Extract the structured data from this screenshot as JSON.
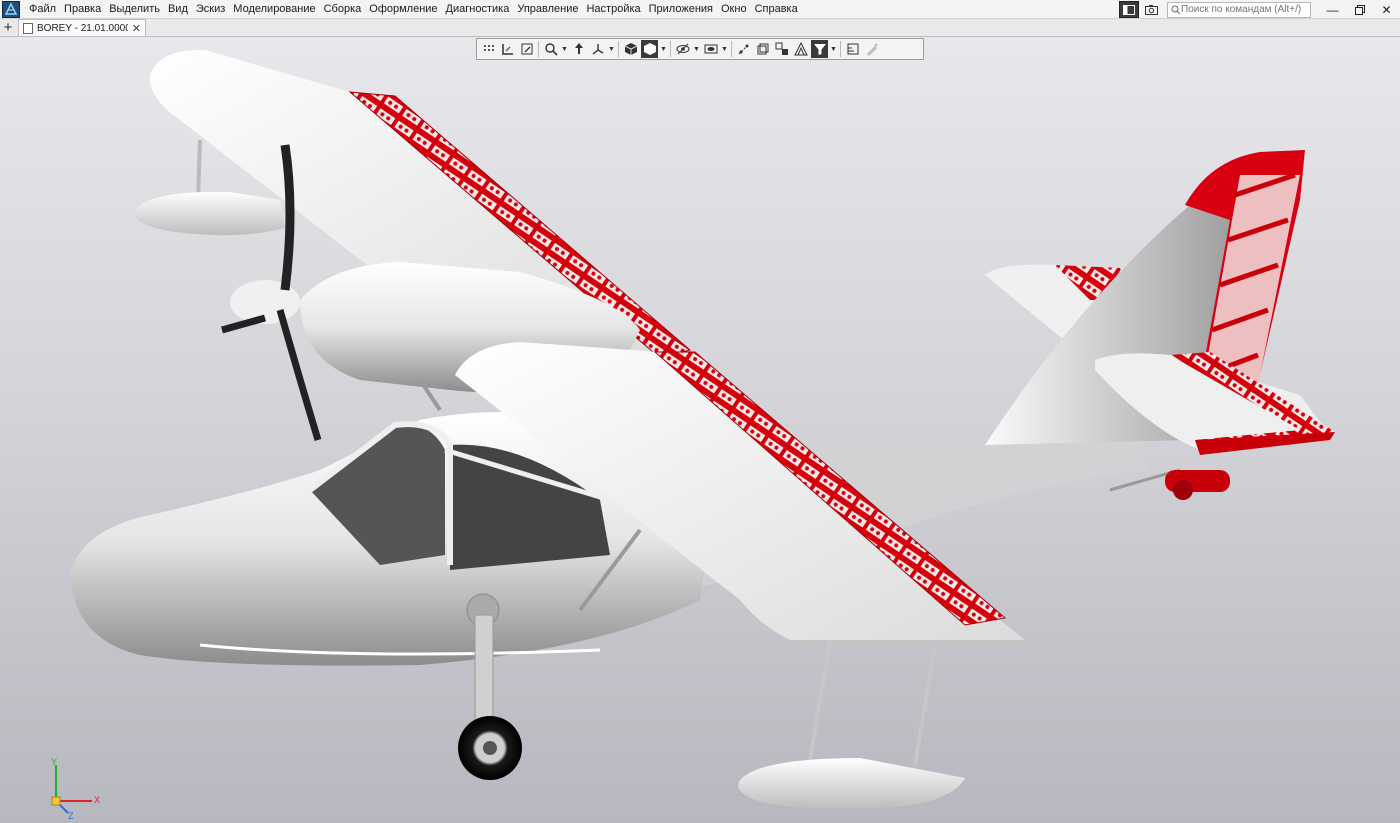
{
  "menu": {
    "items": [
      "Файл",
      "Правка",
      "Выделить",
      "Вид",
      "Эскиз",
      "Моделирование",
      "Сборка",
      "Оформление",
      "Диагностика",
      "Управление",
      "Настройка",
      "Приложения",
      "Окно",
      "Справка"
    ]
  },
  "search": {
    "placeholder": "Поиск по командам (Alt+/)"
  },
  "tabs": {
    "active_title": "BOREY - 21.01.0000.0..."
  },
  "triad": {
    "x_label": "X",
    "y_label": "Y",
    "z_label": "Z"
  },
  "colors": {
    "accent_red": "#c8000a",
    "model_white": "#f2f2f2",
    "toolbar_bg": "#f3f3f3"
  },
  "icons": [
    "app-logo-icon",
    "layout-icon",
    "camera-icon",
    "minimize-icon",
    "restore-icon",
    "close-icon",
    "search-icon"
  ]
}
